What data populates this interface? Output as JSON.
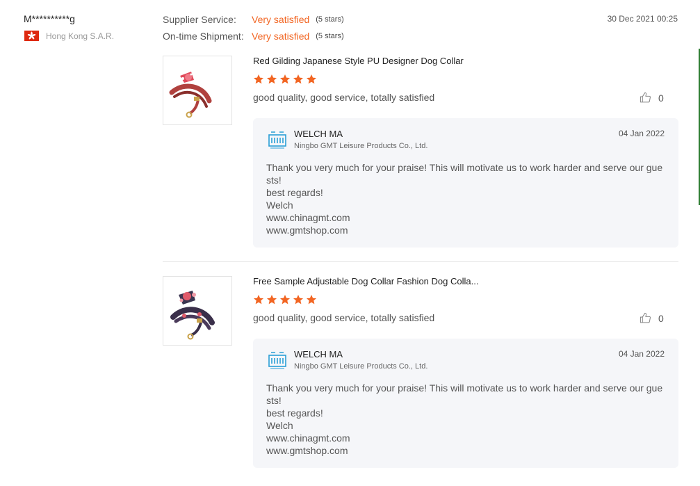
{
  "buyer": {
    "name": "M**********g",
    "location": "Hong Kong S.A.R."
  },
  "ratings": [
    {
      "label": "Supplier Service:",
      "value": "Very satisfied",
      "stars_text": "(5 stars)"
    },
    {
      "label": "On-time Shipment:",
      "value": "Very satisfied",
      "stars_text": "(5 stars)"
    }
  ],
  "review_date": "30 Dec 2021 00:25",
  "colors": {
    "accent": "#f26522",
    "reply_bg": "#f5f6f9",
    "flag_red": "#de2910"
  },
  "items": [
    {
      "title": "Red Gilding Japanese Style PU Designer Dog Collar",
      "rating": 5,
      "comment": "good quality, good service, totally satisfied",
      "likes": "0",
      "reply": {
        "name": "WELCH MA",
        "company": "Ningbo GMT Leisure Products Co., Ltd.",
        "date": "04 Jan 2022",
        "lines": [
          "Thank you very much for your praise! This will motivate us to work harder and serve our guests!",
          "best regards!",
          "Welch",
          "www.chinagmt.com",
          "www.gmtshop.com"
        ]
      }
    },
    {
      "title": "Free Sample Adjustable Dog Collar Fashion Dog Colla...",
      "rating": 5,
      "comment": "good quality, good service, totally satisfied",
      "likes": "0",
      "reply": {
        "name": "WELCH MA",
        "company": "Ningbo GMT Leisure Products Co., Ltd.",
        "date": "04 Jan 2022",
        "lines": [
          "Thank you very much for your praise! This will motivate us to work harder and serve our guests!",
          "best regards!",
          "Welch",
          "www.chinagmt.com",
          "www.gmtshop.com"
        ]
      }
    }
  ]
}
